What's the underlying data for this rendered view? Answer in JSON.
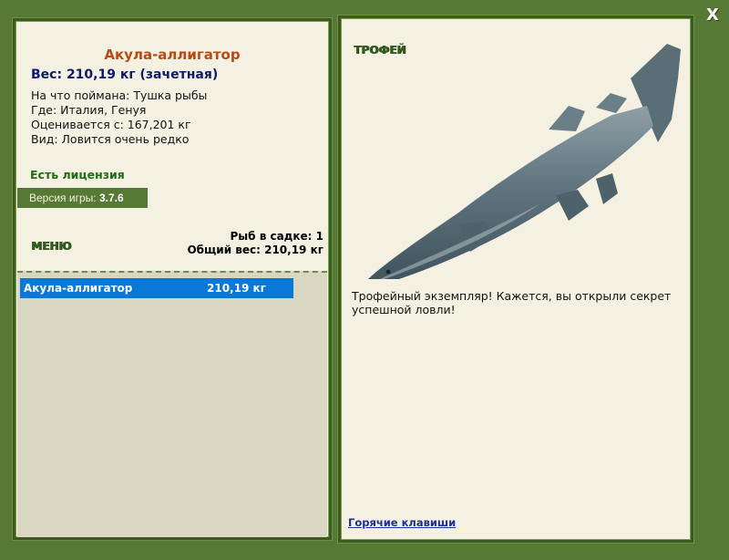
{
  "fish": {
    "name": "Акула-аллигатор",
    "weight_line": "Вес: 210,19 кг (зачетная)",
    "caught_on": "На что поймана: Тушка рыбы",
    "location": "Где: Италия, Генуя",
    "valued_from": "Оценивается с: 167,201 кг",
    "rarity": "Вид: Ловится очень редко"
  },
  "license": "Есть лицензия",
  "version": {
    "label": "Версия игры: ",
    "value": "3.7.6"
  },
  "menu_label": "МЕНЮ",
  "keepnet": {
    "count_line": "Рыб в садке: 1",
    "total_line": "Общий вес: 210,19 кг"
  },
  "catch_list": [
    {
      "name": "Акула-аллигатор",
      "weight": "210,19 кг"
    }
  ],
  "trophy": {
    "label": "ТРОФЕЙ",
    "description": "Трофейный экземпляр! Кажется, вы открыли секрет успешной ловли!"
  },
  "hotkeys_link": "Горячие клавиши",
  "close_label": "X",
  "colors": {
    "background": "#567a35",
    "panel": "#f5f1e2",
    "title": "#b94a14",
    "weight": "#0c1a6e",
    "license": "#1f6b16",
    "selection": "#0a78d6"
  },
  "icons": {
    "close": "close-icon",
    "fish": "shark-image"
  }
}
